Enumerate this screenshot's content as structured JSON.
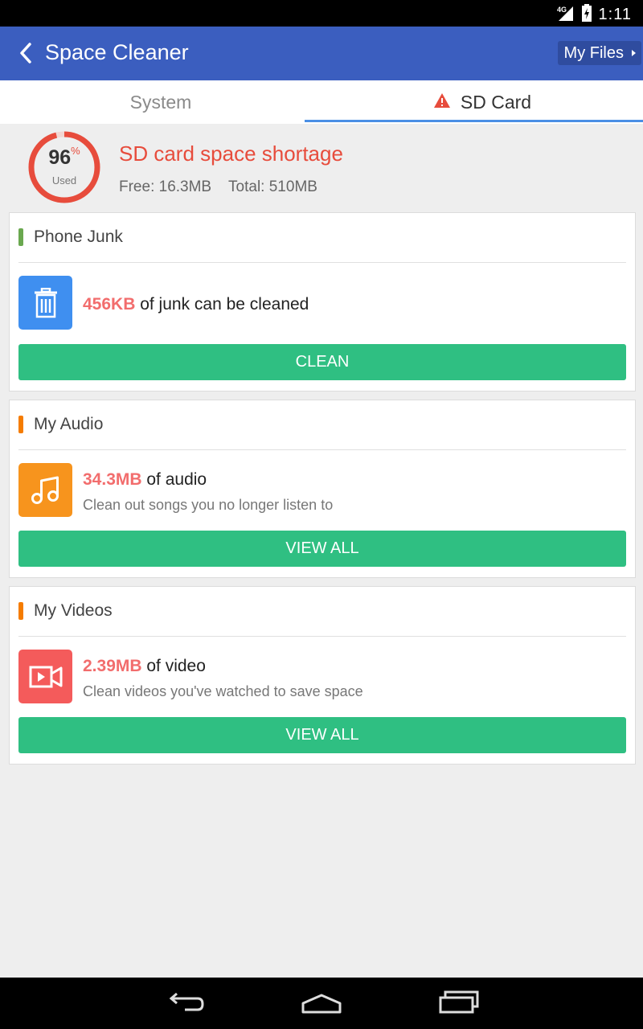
{
  "status": {
    "network": "4G",
    "time": "1:11"
  },
  "appbar": {
    "title": "Space Cleaner",
    "myfiles_label": "My Files"
  },
  "tabs": [
    {
      "label": "System"
    },
    {
      "label": "SD Card"
    }
  ],
  "summary": {
    "percent": "96",
    "percent_sign": "%",
    "used_label": "Used",
    "title": "SD card space shortage",
    "free": "Free: 16.3MB",
    "total": "Total: 510MB"
  },
  "cards": {
    "junk": {
      "title": "Phone Junk",
      "amount": "456KB",
      "text": " of junk can be cleaned",
      "button": "CLEAN"
    },
    "audio": {
      "title": "My Audio",
      "amount": "34.3MB",
      "text": " of audio",
      "subtext": "Clean out songs you no longer listen to",
      "button": "VIEW ALL"
    },
    "video": {
      "title": "My Videos",
      "amount": "2.39MB",
      "text": " of video",
      "subtext": "Clean videos you've watched to save space",
      "button": "VIEW ALL"
    }
  },
  "colors": {
    "appbar": "#3b5ebf",
    "warning": "#e74c3c",
    "button": "#2fbf82",
    "junk_icon": "#3f8ff0",
    "audio_icon": "#f7941d",
    "video_icon": "#f45b5b",
    "junk_bar": "#6aa84f",
    "audio_bar": "#f57c00",
    "video_bar": "#f57c00"
  },
  "icons": [
    "back-arrow-icon",
    "warning-icon",
    "trash-icon",
    "music-note-icon",
    "video-camera-icon",
    "nav-back-icon",
    "nav-home-icon",
    "nav-recents-icon"
  ]
}
